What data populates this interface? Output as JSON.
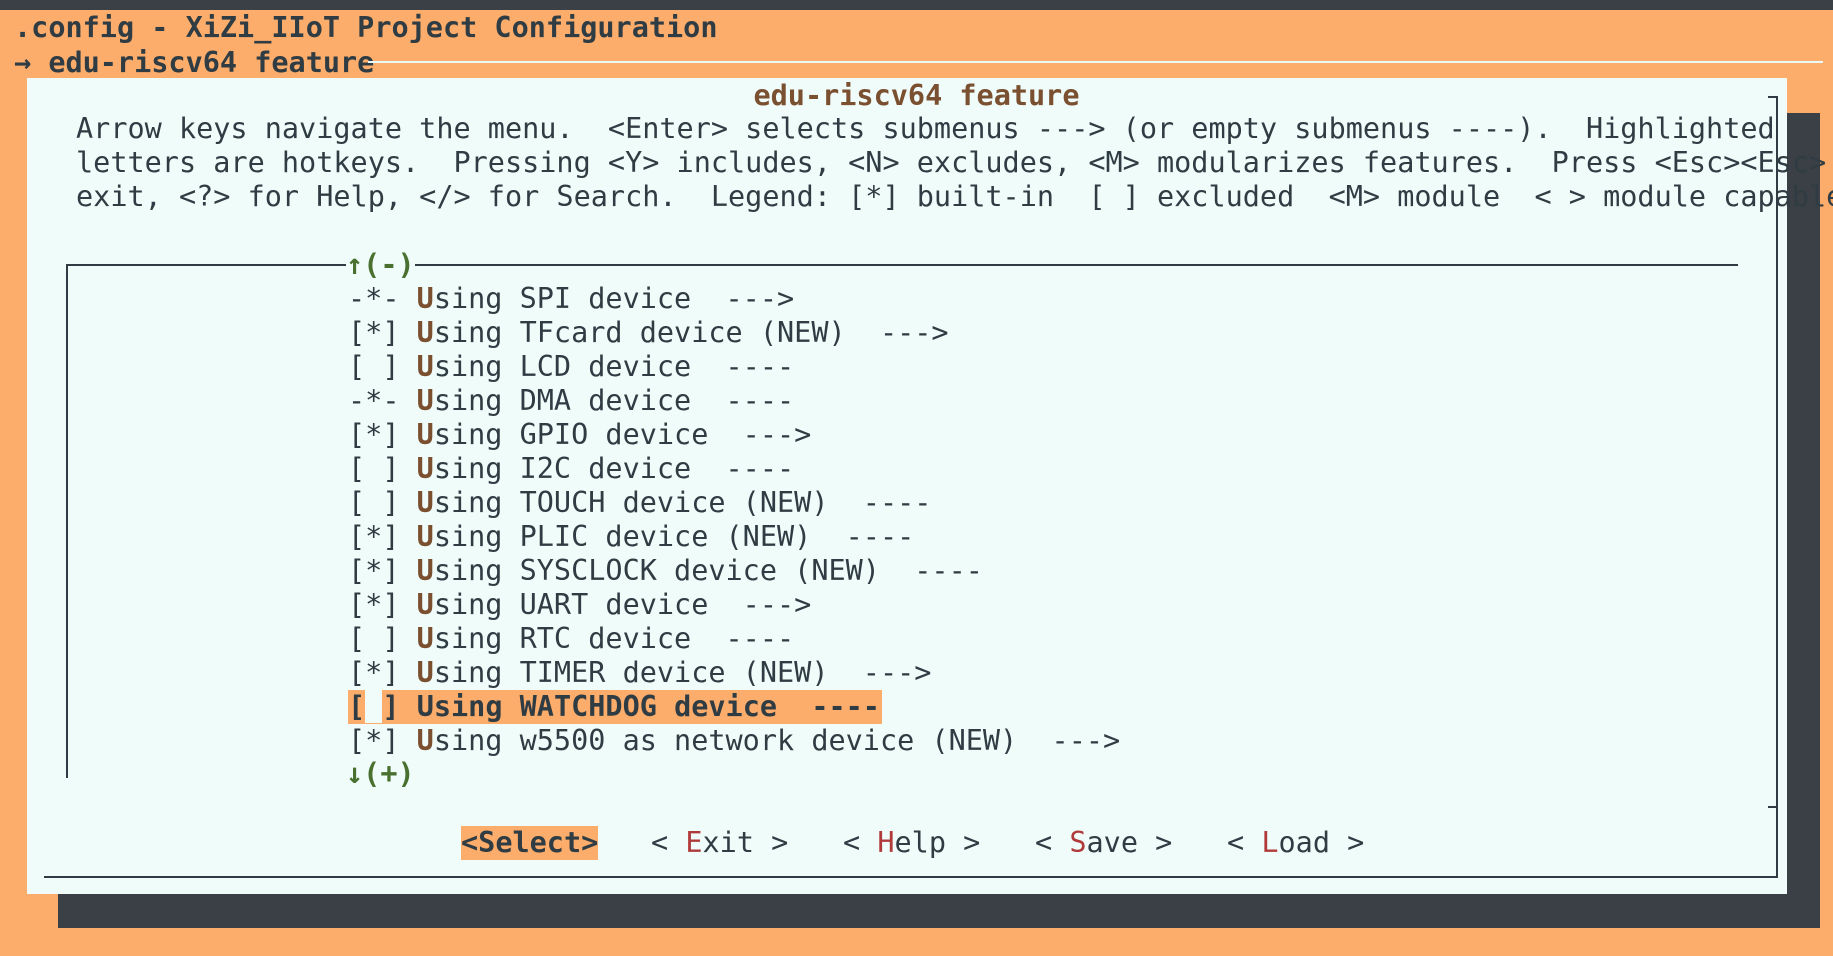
{
  "window": {
    "title": ".config - XiZi_IIoT Project Configuration",
    "breadcrumb": "→ edu-riscv64 feature"
  },
  "dialog": {
    "title": "edu-riscv64 feature",
    "help_lines": [
      "Arrow keys navigate the menu.  <Enter> selects submenus ---> (or empty submenus ----).  Highlighted",
      "letters are hotkeys.  Pressing <Y> includes, <N> excludes, <M> modularizes features.  Press <Esc><Esc> to",
      "exit, <?> for Help, </> for Search.  Legend: [*] built-in  [ ] excluded  <M> module  < > module capable"
    ]
  },
  "menu": {
    "scroll_up": "↑(-)",
    "scroll_down": "↓(+)",
    "items": [
      {
        "state": "-*-",
        "hotkey": "U",
        "rest": "sing SPI device  --->"
      },
      {
        "state": "[*]",
        "hotkey": "U",
        "rest": "sing TFcard device (NEW)  --->"
      },
      {
        "state": "[ ]",
        "hotkey": "U",
        "rest": "sing LCD device  ----"
      },
      {
        "state": "-*-",
        "hotkey": "U",
        "rest": "sing DMA device  ----"
      },
      {
        "state": "[*]",
        "hotkey": "U",
        "rest": "sing GPIO device  --->"
      },
      {
        "state": "[ ]",
        "hotkey": "U",
        "rest": "sing I2C device  ----"
      },
      {
        "state": "[ ]",
        "hotkey": "U",
        "rest": "sing TOUCH device (NEW)  ----"
      },
      {
        "state": "[*]",
        "hotkey": "U",
        "rest": "sing PLIC device (NEW)  ----"
      },
      {
        "state": "[*]",
        "hotkey": "U",
        "rest": "sing SYSCLOCK device (NEW)  ----"
      },
      {
        "state": "[*]",
        "hotkey": "U",
        "rest": "sing UART device  --->"
      },
      {
        "state": "[ ]",
        "hotkey": "U",
        "rest": "sing RTC device  ----"
      },
      {
        "state": "[*]",
        "hotkey": "U",
        "rest": "sing TIMER device (NEW)  --->"
      },
      {
        "state_left": "[",
        "state_cursor": " ",
        "state_right": "]",
        "label": "Using WATCHDOG device  ----",
        "selected": true
      },
      {
        "state": "[*]",
        "hotkey": "U",
        "rest": "sing w5500 as network device (NEW)  --->"
      }
    ]
  },
  "buttons": {
    "select": "<Select>",
    "exit": {
      "pre": "< ",
      "hot": "E",
      "post": "xit >"
    },
    "help": {
      "pre": "< ",
      "hot": "H",
      "post": "elp >"
    },
    "save": {
      "pre": "< ",
      "hot": "S",
      "post": "ave >"
    },
    "load": {
      "pre": "< ",
      "hot": "L",
      "post": "oad >"
    }
  }
}
